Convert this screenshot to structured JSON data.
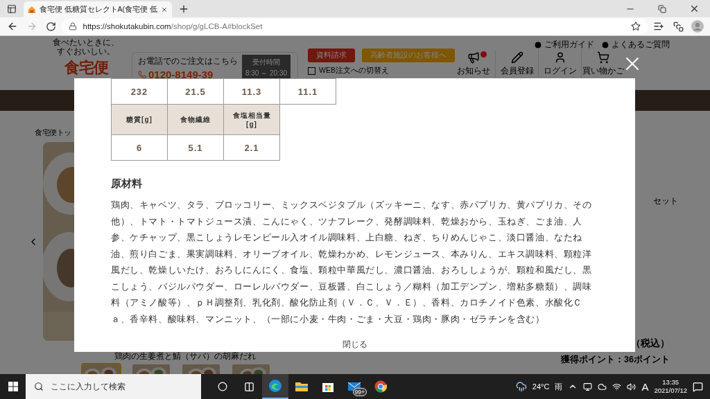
{
  "browser": {
    "tab_title": "食宅便 低糖質セレクトA(食宅便 低",
    "url_host": "https://shokutakubin.com",
    "url_path": "/shop/g/gLCB-A#blockSet"
  },
  "site_header": {
    "logo_tagline": "食べたいときに、すぐおいしい。",
    "logo_text": "食宅便",
    "phone_label": "お電話でのご注文はこちら",
    "phone": "0120-8149-39",
    "hours_label": "受付時間",
    "hours": "8:30 ～ 20:30",
    "buttons": [
      {
        "label": "資料請求",
        "kind": "request"
      },
      {
        "label": "高齢者施設のお客様へ",
        "kind": "facility"
      }
    ],
    "web_switch": {
      "label": "WEB注文への切替え",
      "checked": false
    },
    "links": [
      "ご利用ガイド",
      "よくあるご質問"
    ],
    "icons": [
      {
        "kind": "megaphone",
        "label": "お知らせ",
        "badge": true
      },
      {
        "kind": "pencil",
        "label": "会員登録",
        "badge": false
      },
      {
        "kind": "person",
        "label": "ログイン",
        "badge": false
      },
      {
        "kind": "cart",
        "label": "買い物かご",
        "badge": false
      }
    ]
  },
  "breadcrumb": "食宅便トッ",
  "product": {
    "title_end": "セット",
    "caption": "鶏肉の生姜煮と鯖（サバ）の胡麻だれ",
    "price_suffix": "（税込）",
    "points": "獲得ポイント：36ポイント",
    "thumbnails": [
      {
        "selected": true
      },
      {
        "selected": false
      },
      {
        "selected": false
      },
      {
        "selected": false
      }
    ]
  },
  "modal": {
    "nutrition": [
      {
        "kind": "values",
        "cells": [
          "232",
          "21.5",
          "11.3",
          "11.1"
        ]
      },
      {
        "kind": "header",
        "cells": [
          "糖質[g]",
          "食物繊維",
          "食塩相当量[g]"
        ]
      },
      {
        "kind": "values",
        "cells": [
          "6",
          "5.1",
          "2.1"
        ]
      }
    ],
    "ingredients_title": "原材料",
    "ingredients": "鶏肉、キャベツ、タラ、ブロッコリー、ミックスベジタブル（ズッキーニ、なす、赤パプリカ、黄パプリカ、その他）、トマト・トマトジュース漬、こんにゃく、ツナフレーク、発酵調味料、乾燥おから、玉ねぎ、ごま油、人参、ケチャップ、黒こしょうレモンピール入オイル調味料、上白糖、ねぎ、ちりめんじゃこ、淡口醤油、なたね油、煎り白ごま、果実調味料、オリーブオイル、乾燥わかめ、レモンジュース、本みりん、エキス調味料、顆粒洋風だし、乾燥しいたけ、おろしにんにく、食塩、顆粒中華風だし、濃口醤油、おろししょうが、顆粒和風だし、黒こしょう、バジルパウダー、ローレルパウダー、豆板醤、白こしょう／糊料（加工デンプン、増粘多糖類）、調味料（アミノ酸等）、ｐＨ調整剤、乳化剤、酸化防止剤（Ｖ．Ｃ、Ｖ．Ｅ）、香料、カロチノイド色素、水酸化Ｃａ、香辛料、酸味料、マンニット、（一部に小麦・牛肉・ごま・大豆・鶏肉・豚肉・ゼラチンを含む）",
    "close": "閉じる"
  },
  "taskbar": {
    "search_placeholder": "ここに入力して検索",
    "mail_badge": "99+",
    "temperature": "24°C",
    "weather": "雨",
    "ime": "A",
    "time": "13:35",
    "date": "2021/07/12"
  }
}
